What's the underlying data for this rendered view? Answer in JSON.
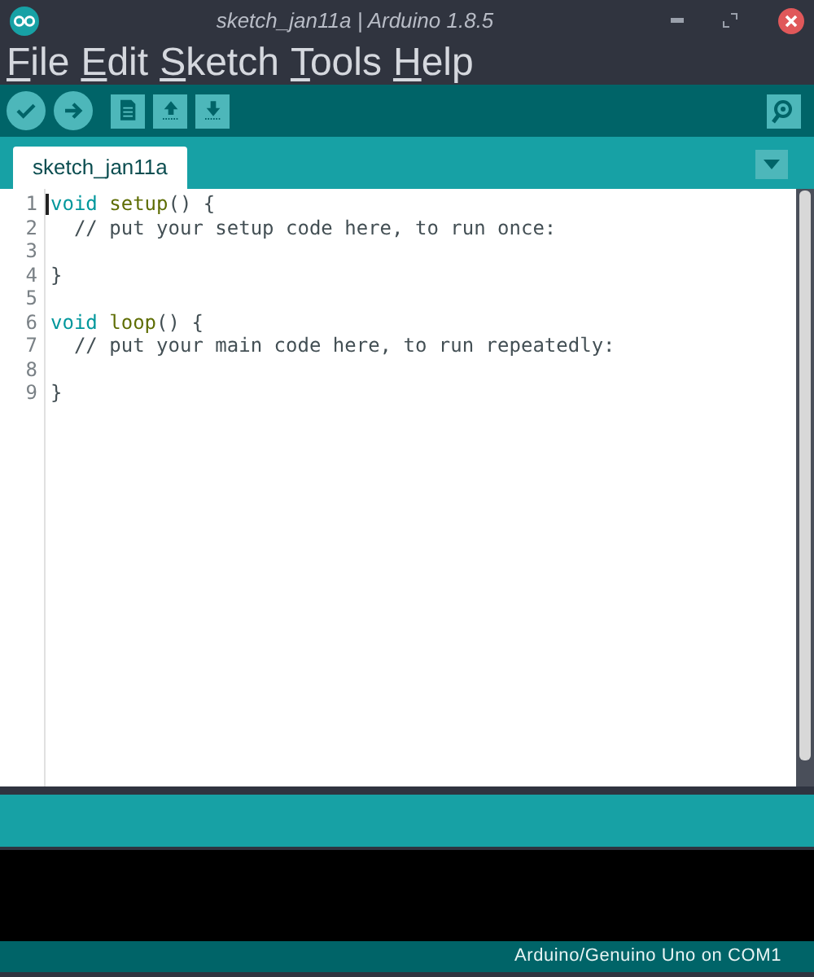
{
  "window": {
    "title": "sketch_jan11a | Arduino 1.8.5"
  },
  "menu": [
    "File",
    "Edit",
    "Sketch",
    "Tools",
    "Help"
  ],
  "toolbar": [
    {
      "kind": "verify"
    },
    {
      "kind": "upload"
    },
    {
      "kind": "new"
    },
    {
      "kind": "open"
    },
    {
      "kind": "save"
    }
  ],
  "tabs": [
    {
      "label": "sketch_jan11a",
      "selected": true
    }
  ],
  "editor": {
    "lines": [
      {
        "number": "1",
        "cursor": true,
        "tokens": [
          {
            "text": "void ",
            "kind": "keyword"
          },
          {
            "text": "setup",
            "kind": "function"
          },
          {
            "text": "() {",
            "kind": "plain"
          }
        ]
      },
      {
        "number": "2",
        "cursor": false,
        "tokens": [
          {
            "text": "  // put your setup code here, to run once:",
            "kind": "comment"
          }
        ]
      },
      {
        "number": "3",
        "cursor": false
      },
      {
        "number": "4",
        "cursor": false,
        "tokens": [
          {
            "text": "}",
            "kind": "plain"
          }
        ]
      },
      {
        "number": "5",
        "cursor": false
      },
      {
        "number": "6",
        "cursor": false,
        "tokens": [
          {
            "text": "void ",
            "kind": "keyword"
          },
          {
            "text": "loop",
            "kind": "function"
          },
          {
            "text": "() {",
            "kind": "plain"
          }
        ]
      },
      {
        "number": "7",
        "cursor": false,
        "tokens": [
          {
            "text": "  // put your main code here, to run repeatedly:",
            "kind": "comment"
          }
        ]
      },
      {
        "number": "8",
        "cursor": false
      },
      {
        "number": "9",
        "cursor": false,
        "tokens": [
          {
            "text": "}",
            "kind": "plain"
          }
        ]
      }
    ]
  },
  "status_bar": {
    "board": "Arduino/Genuino Uno on COM1"
  }
}
